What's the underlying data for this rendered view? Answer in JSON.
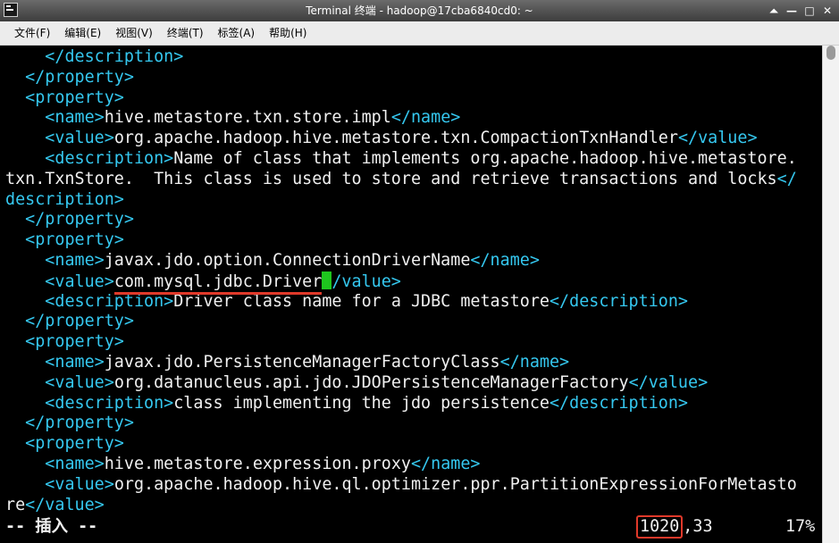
{
  "window": {
    "title": "Terminal 终端 - hadoop@17cba6840cd0: ~",
    "controls": {
      "shade": "⏶",
      "minimize": "—",
      "maximize": "□",
      "close": "✕"
    }
  },
  "menu": [
    "文件(F)",
    "编辑(E)",
    "视图(V)",
    "终端(T)",
    "标签(A)",
    "帮助(H)"
  ],
  "terminal": {
    "lines": [
      [
        {
          "t": "    "
        },
        {
          "c": "tag",
          "t": "</description>"
        }
      ],
      [
        {
          "t": "  "
        },
        {
          "c": "tag",
          "t": "</property>"
        }
      ],
      [
        {
          "t": "  "
        },
        {
          "c": "tag",
          "t": "<property>"
        }
      ],
      [
        {
          "t": "    "
        },
        {
          "c": "tag",
          "t": "<name>"
        },
        {
          "t": "hive.metastore.txn.store.impl"
        },
        {
          "c": "tag",
          "t": "</name>"
        }
      ],
      [
        {
          "t": "    "
        },
        {
          "c": "tag",
          "t": "<value>"
        },
        {
          "t": "org.apache.hadoop.hive.metastore.txn.CompactionTxnHandler"
        },
        {
          "c": "tag",
          "t": "</value>"
        }
      ],
      [
        {
          "t": "    "
        },
        {
          "c": "tag",
          "t": "<description>"
        },
        {
          "t": "Name of class that implements org.apache.hadoop.hive.metastore."
        }
      ],
      [
        {
          "t": "txn.TxnStore.  This class is used to store and retrieve transactions and locks"
        },
        {
          "c": "tag",
          "t": "</"
        }
      ],
      [
        {
          "c": "tag",
          "t": "description>"
        }
      ],
      [
        {
          "t": "  "
        },
        {
          "c": "tag",
          "t": "</property>"
        }
      ],
      [
        {
          "t": "  "
        },
        {
          "c": "tag",
          "t": "<property>"
        }
      ],
      [
        {
          "t": "    "
        },
        {
          "c": "tag",
          "t": "<name>"
        },
        {
          "t": "javax.jdo.option.ConnectionDriverName"
        },
        {
          "c": "tag",
          "t": "</name>"
        }
      ],
      [
        {
          "t": "    "
        },
        {
          "c": "tag",
          "t": "<value>"
        },
        {
          "c": "hl",
          "t": "com.mysql.jdbc.Driver"
        },
        {
          "cursor": true
        },
        {
          "c": "tag",
          "t": "/value>"
        }
      ],
      [
        {
          "t": "    "
        },
        {
          "c": "tag",
          "t": "<description>"
        },
        {
          "t": "Driver class name for a JDBC metastore"
        },
        {
          "c": "tag",
          "t": "</description>"
        }
      ],
      [
        {
          "t": "  "
        },
        {
          "c": "tag",
          "t": "</property>"
        }
      ],
      [
        {
          "t": "  "
        },
        {
          "c": "tag",
          "t": "<property>"
        }
      ],
      [
        {
          "t": "    "
        },
        {
          "c": "tag",
          "t": "<name>"
        },
        {
          "t": "javax.jdo.PersistenceManagerFactoryClass"
        },
        {
          "c": "tag",
          "t": "</name>"
        }
      ],
      [
        {
          "t": "    "
        },
        {
          "c": "tag",
          "t": "<value>"
        },
        {
          "t": "org.datanucleus.api.jdo.JDOPersistenceManagerFactory"
        },
        {
          "c": "tag",
          "t": "</value>"
        }
      ],
      [
        {
          "t": "    "
        },
        {
          "c": "tag",
          "t": "<description>"
        },
        {
          "t": "class implementing the jdo persistence"
        },
        {
          "c": "tag",
          "t": "</description>"
        }
      ],
      [
        {
          "t": "  "
        },
        {
          "c": "tag",
          "t": "</property>"
        }
      ],
      [
        {
          "t": "  "
        },
        {
          "c": "tag",
          "t": "<property>"
        }
      ],
      [
        {
          "t": "    "
        },
        {
          "c": "tag",
          "t": "<name>"
        },
        {
          "t": "hive.metastore.expression.proxy"
        },
        {
          "c": "tag",
          "t": "</name>"
        }
      ],
      [
        {
          "t": "    "
        },
        {
          "c": "tag",
          "t": "<value>"
        },
        {
          "t": "org.apache.hadoop.hive.ql.optimizer.ppr.PartitionExpressionForMetasto"
        }
      ],
      [
        {
          "t": "re"
        },
        {
          "c": "tag",
          "t": "</value>"
        }
      ]
    ]
  },
  "status": {
    "mode": "-- 插入 --",
    "line": "1020",
    "column": ",33",
    "percent": "17%"
  },
  "colors": {
    "tag": "#35c8f0",
    "text": "#f0f0f0",
    "cursor": "#1ec51e",
    "annotation": "#e0392a"
  }
}
